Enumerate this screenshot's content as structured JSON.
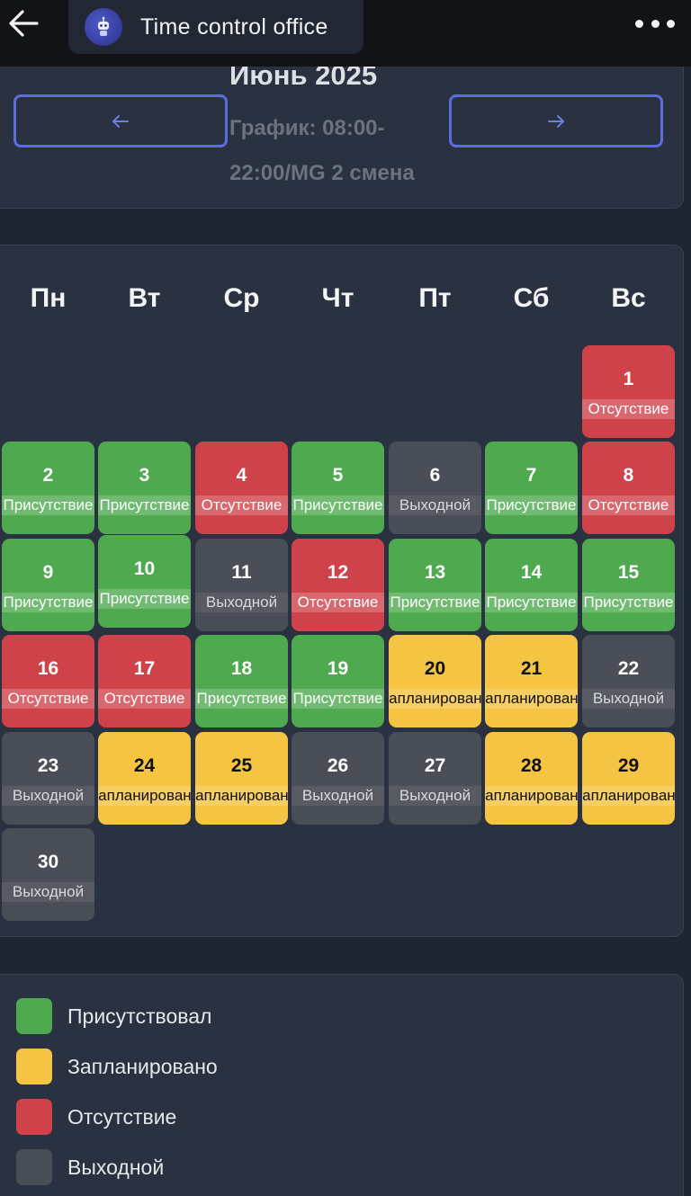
{
  "header": {
    "title": "Time control office",
    "back_icon": "arrow-left-icon",
    "menu_icon": "more-horizontal-icon",
    "avatar_icon": "robot-icon"
  },
  "month": {
    "title": "Июнь 2025",
    "schedule": "График: 08:00-22:00/MG 2 смена",
    "prev_icon": "arrow-left-icon",
    "next_icon": "arrow-right-icon"
  },
  "weekdays": [
    "Пн",
    "Вт",
    "Ср",
    "Чт",
    "Пт",
    "Сб",
    "Вс"
  ],
  "colors": {
    "present": "#4ea94f",
    "planned": "#f5c443",
    "absent": "#d0424a",
    "off": "#4a4e56",
    "accent": "#5b6ee1"
  },
  "days": [
    {
      "num": "1",
      "status": "Отсутствие",
      "type": "absent"
    },
    {
      "num": "2",
      "status": "Присутствие",
      "type": "present"
    },
    {
      "num": "3",
      "status": "Присутствие",
      "type": "present"
    },
    {
      "num": "4",
      "status": "Отсутствие",
      "type": "absent"
    },
    {
      "num": "5",
      "status": "Присутствие",
      "type": "present"
    },
    {
      "num": "6",
      "status": "Выходной",
      "type": "off"
    },
    {
      "num": "7",
      "status": "Присутствие",
      "type": "present"
    },
    {
      "num": "8",
      "status": "Отсутствие",
      "type": "absent"
    },
    {
      "num": "9",
      "status": "Присутствие",
      "type": "present"
    },
    {
      "num": "10",
      "status": "Присутствие",
      "type": "present"
    },
    {
      "num": "11",
      "status": "Выходной",
      "type": "off"
    },
    {
      "num": "12",
      "status": "Отсутствие",
      "type": "absent"
    },
    {
      "num": "13",
      "status": "Присутствие",
      "type": "present"
    },
    {
      "num": "14",
      "status": "Присутствие",
      "type": "present"
    },
    {
      "num": "15",
      "status": "Присутствие",
      "type": "present"
    },
    {
      "num": "16",
      "status": "Отсутствие",
      "type": "absent"
    },
    {
      "num": "17",
      "status": "Отсутствие",
      "type": "absent"
    },
    {
      "num": "18",
      "status": "Присутствие",
      "type": "present"
    },
    {
      "num": "19",
      "status": "Присутствие",
      "type": "present"
    },
    {
      "num": "20",
      "status": "Запланировано",
      "type": "planned"
    },
    {
      "num": "21",
      "status": "Запланировано",
      "type": "planned"
    },
    {
      "num": "22",
      "status": "Выходной",
      "type": "off"
    },
    {
      "num": "23",
      "status": "Выходной",
      "type": "off"
    },
    {
      "num": "24",
      "status": "Запланировано",
      "type": "planned"
    },
    {
      "num": "25",
      "status": "Запланировано",
      "type": "planned"
    },
    {
      "num": "26",
      "status": "Выходной",
      "type": "off"
    },
    {
      "num": "27",
      "status": "Выходной",
      "type": "off"
    },
    {
      "num": "28",
      "status": "Запланировано",
      "type": "planned"
    },
    {
      "num": "29",
      "status": "Запланировано",
      "type": "planned"
    },
    {
      "num": "30",
      "status": "Выходной",
      "type": "off"
    }
  ],
  "legend": [
    {
      "label": "Присутствовал",
      "type": "present"
    },
    {
      "label": "Запланировано",
      "type": "planned"
    },
    {
      "label": "Отсутствие",
      "type": "absent"
    },
    {
      "label": "Выходной",
      "type": "off"
    }
  ]
}
